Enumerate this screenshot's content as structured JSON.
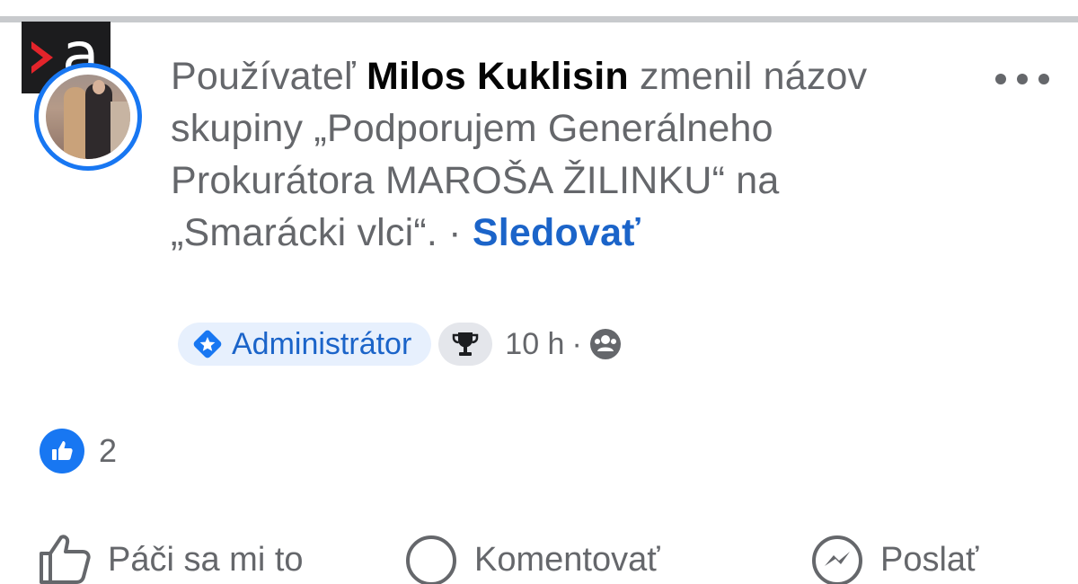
{
  "brand": {
    "letter": "a"
  },
  "post": {
    "prefix": "Používateľ",
    "author": "Milos Kuklisin",
    "action_text": "zmenil názov skupiny „Podporujem Generálneho Prokurátora MAROŠA ŽILINKU“ na „Smarácki vlci“. ·",
    "follow_label": "Sledovať"
  },
  "meta": {
    "role_badge": "Administrátor",
    "time": "10 h",
    "separator": "·"
  },
  "reactions": {
    "count": "2"
  },
  "actions": {
    "like_label": "Páči sa mi to",
    "comment_label": "Komentovať",
    "send_label": "Poslať"
  },
  "colors": {
    "accent": "#1877f2",
    "link": "#1b64c9",
    "muted_text": "#65676b",
    "name_text": "#050505",
    "badge_bg": "#e7f0fd",
    "brand_red": "#e3242b",
    "brand_dark": "#1c1c1e"
  },
  "icons": [
    "more-options-icon",
    "admin-diamond-icon",
    "trophy-icon",
    "audience-group-icon",
    "like-reaction-icon",
    "thumbs-up-icon",
    "comment-icon",
    "messenger-icon"
  ]
}
